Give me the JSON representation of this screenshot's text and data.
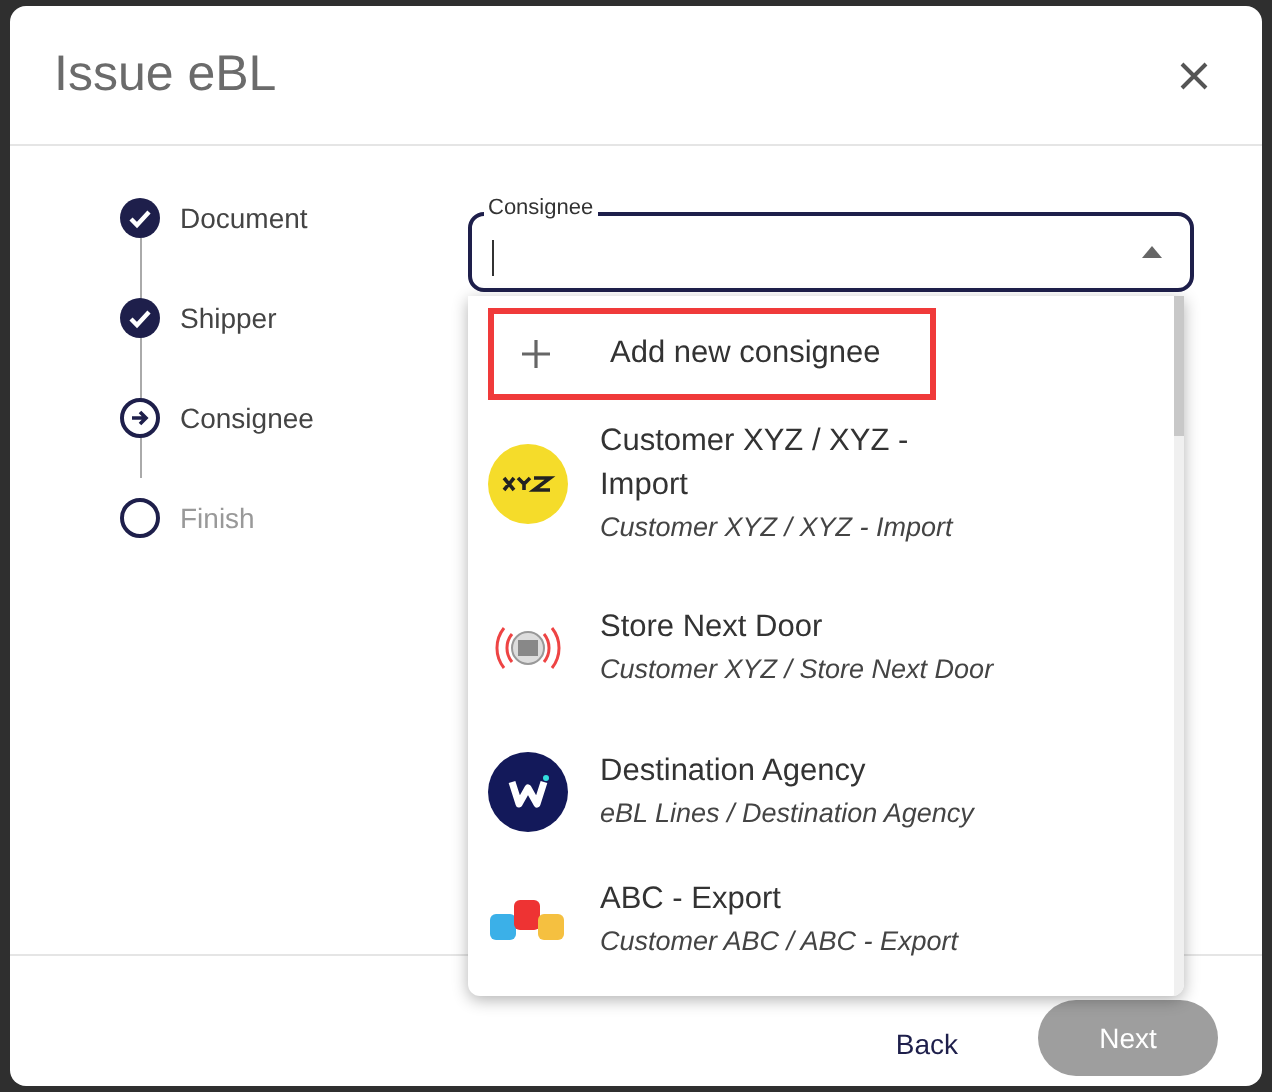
{
  "dialog": {
    "title": "Issue eBL"
  },
  "steps": [
    {
      "label": "Document",
      "kind": "done"
    },
    {
      "label": "Shipper",
      "kind": "done"
    },
    {
      "label": "Consignee",
      "kind": "current"
    },
    {
      "label": "Finish",
      "kind": "todo"
    }
  ],
  "consignee_field": {
    "label": "Consignee",
    "expanded": true
  },
  "add_option": {
    "label": "Add new consignee",
    "highlighted": true
  },
  "options": [
    {
      "name": "Customer XYZ / XYZ - Import",
      "path": "Customer XYZ / XYZ - Import",
      "kind": "xyz"
    },
    {
      "name": "Store Next Door",
      "path": "Customer XYZ / Store Next Door",
      "kind": "store"
    },
    {
      "name": "Destination Agency",
      "path": "eBL Lines / Destination Agency",
      "kind": "w"
    },
    {
      "name": "ABC - Export",
      "path": "Customer ABC / ABC - Export",
      "kind": "abc"
    }
  ],
  "footer": {
    "back": "Back",
    "next": "Next"
  }
}
